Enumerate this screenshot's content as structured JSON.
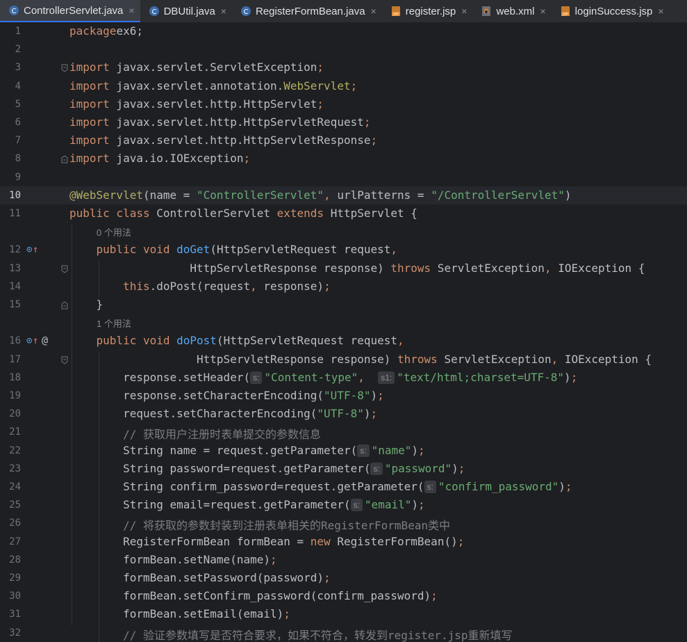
{
  "tabs": [
    {
      "label": "ControllerServlet.java",
      "icon": "java-class-icon",
      "active": true
    },
    {
      "label": "DBUtil.java",
      "icon": "java-class-icon",
      "active": false
    },
    {
      "label": "RegisterFormBean.java",
      "icon": "java-class-icon",
      "active": false
    },
    {
      "label": "register.jsp",
      "icon": "jsp-file-icon",
      "active": false
    },
    {
      "label": "web.xml",
      "icon": "xml-file-icon",
      "active": false
    },
    {
      "label": "loginSuccess.jsp",
      "icon": "jsp-file-icon",
      "active": false
    }
  ],
  "tab_close_glyph": "×",
  "hints": {
    "usages_0": "0 个用法",
    "usages_1": "1 个用法"
  },
  "lines": [
    {
      "n": "1",
      "segs": [
        [
          "kw",
          "package"
        ],
        [
          "",
          "ex6;"
        ]
      ]
    },
    {
      "n": "2",
      "segs": []
    },
    {
      "n": "3",
      "segs": [
        [
          "kw",
          "import"
        ],
        [
          "",
          " javax.servlet.ServletException"
        ],
        [
          "kw",
          ";"
        ]
      ]
    },
    {
      "n": "4",
      "segs": [
        [
          "kw",
          "import"
        ],
        [
          "",
          " javax.servlet.annotation."
        ],
        [
          "ann",
          "WebServlet"
        ],
        [
          "kw",
          ";"
        ]
      ]
    },
    {
      "n": "5",
      "segs": [
        [
          "kw",
          "import"
        ],
        [
          "",
          " javax.servlet.http.HttpServlet"
        ],
        [
          "kw",
          ";"
        ]
      ]
    },
    {
      "n": "6",
      "segs": [
        [
          "kw",
          "import"
        ],
        [
          "",
          " javax.servlet.http.HttpServletRequest"
        ],
        [
          "kw",
          ";"
        ]
      ]
    },
    {
      "n": "7",
      "segs": [
        [
          "kw",
          "import"
        ],
        [
          "",
          " javax.servlet.http.HttpServletResponse"
        ],
        [
          "kw",
          ";"
        ]
      ]
    },
    {
      "n": "8",
      "segs": [
        [
          "kw",
          "import"
        ],
        [
          "",
          " java.io.IOException"
        ],
        [
          "kw",
          ";"
        ]
      ]
    },
    {
      "n": "9",
      "segs": []
    },
    {
      "n": "10",
      "segs": [
        [
          "ann",
          "@WebServlet"
        ],
        [
          "",
          "(name = "
        ],
        [
          "str",
          "\"ControllerServlet\""
        ],
        [
          "kw",
          ","
        ],
        [
          "",
          " urlPatterns = "
        ],
        [
          "str",
          "\"/ControllerServlet\""
        ],
        [
          "",
          ")"
        ]
      ]
    },
    {
      "n": "11",
      "segs": [
        [
          "kw",
          "public class"
        ],
        [
          "",
          " ControllerServlet "
        ],
        [
          "kw",
          "extends"
        ],
        [
          "",
          " HttpServlet {"
        ]
      ]
    },
    {
      "n": "12",
      "segs": [
        [
          "",
          "    "
        ],
        [
          "kw",
          "public void"
        ],
        [
          "",
          " "
        ],
        [
          "fn",
          "doGet"
        ],
        [
          "",
          "(HttpServletRequest request"
        ],
        [
          "kw",
          ","
        ]
      ]
    },
    {
      "n": "13",
      "segs": [
        [
          "",
          "                  HttpServletResponse response) "
        ],
        [
          "kw",
          "throws"
        ],
        [
          "",
          " ServletException"
        ],
        [
          "kw",
          ","
        ],
        [
          "",
          " IOException {"
        ]
      ]
    },
    {
      "n": "14",
      "segs": [
        [
          "",
          "        "
        ],
        [
          "kw",
          "this"
        ],
        [
          "",
          ".doPost(request"
        ],
        [
          "kw",
          ","
        ],
        [
          "",
          " response)"
        ],
        [
          "kw",
          ";"
        ]
      ]
    },
    {
      "n": "15",
      "segs": [
        [
          "",
          "    }"
        ]
      ]
    },
    {
      "n": "16",
      "segs": [
        [
          "",
          "    "
        ],
        [
          "kw",
          "public void"
        ],
        [
          "",
          " "
        ],
        [
          "fn",
          "doPost"
        ],
        [
          "",
          "(HttpServletRequest request"
        ],
        [
          "kw",
          ","
        ]
      ]
    },
    {
      "n": "17",
      "segs": [
        [
          "",
          "                   HttpServletResponse response) "
        ],
        [
          "kw",
          "throws"
        ],
        [
          "",
          " ServletException"
        ],
        [
          "kw",
          ","
        ],
        [
          "",
          " IOException {"
        ]
      ]
    },
    {
      "n": "18",
      "segs": [
        [
          "",
          "        response.setHeader("
        ],
        [
          "ph",
          "s:"
        ],
        [
          "str",
          "\"Content-type\""
        ],
        [
          "kw",
          ","
        ],
        [
          "",
          "  "
        ],
        [
          "ph",
          "s1:"
        ],
        [
          "str",
          "\"text/html;charset=UTF-8\""
        ],
        [
          "",
          ")"
        ],
        [
          "kw",
          ";"
        ]
      ]
    },
    {
      "n": "19",
      "segs": [
        [
          "",
          "        response.setCharacterEncoding("
        ],
        [
          "str",
          "\"UTF-8\""
        ],
        [
          "",
          ")"
        ],
        [
          "kw",
          ";"
        ]
      ]
    },
    {
      "n": "20",
      "segs": [
        [
          "",
          "        request.setCharacterEncoding("
        ],
        [
          "str",
          "\"UTF-8\""
        ],
        [
          "",
          ")"
        ],
        [
          "kw",
          ";"
        ]
      ]
    },
    {
      "n": "21",
      "segs": [
        [
          "",
          "        "
        ],
        [
          "cm",
          "// 获取用户注册时表单提交的参数信息"
        ]
      ]
    },
    {
      "n": "22",
      "segs": [
        [
          "",
          "        String name = request.getParameter("
        ],
        [
          "ph",
          "s:"
        ],
        [
          "str",
          "\"name\""
        ],
        [
          "",
          ")"
        ],
        [
          "kw",
          ";"
        ]
      ]
    },
    {
      "n": "23",
      "segs": [
        [
          "",
          "        String password=request.getParameter("
        ],
        [
          "ph",
          "s:"
        ],
        [
          "str",
          "\"password\""
        ],
        [
          "",
          ")"
        ],
        [
          "kw",
          ";"
        ]
      ]
    },
    {
      "n": "24",
      "segs": [
        [
          "",
          "        String confirm_password=request.getParameter("
        ],
        [
          "ph",
          "s:"
        ],
        [
          "str",
          "\"confirm_password\""
        ],
        [
          "",
          ")"
        ],
        [
          "kw",
          ";"
        ]
      ]
    },
    {
      "n": "25",
      "segs": [
        [
          "",
          "        String email=request.getParameter("
        ],
        [
          "ph",
          "s:"
        ],
        [
          "str",
          "\"email\""
        ],
        [
          "",
          ")"
        ],
        [
          "kw",
          ";"
        ]
      ]
    },
    {
      "n": "26",
      "segs": [
        [
          "",
          "        "
        ],
        [
          "cm",
          "// 将获取的参数封装到注册表单相关的RegisterFormBean类中"
        ]
      ]
    },
    {
      "n": "27",
      "segs": [
        [
          "",
          "        RegisterFormBean formBean = "
        ],
        [
          "kw",
          "new"
        ],
        [
          "",
          " RegisterFormBean()"
        ],
        [
          "kw",
          ";"
        ]
      ]
    },
    {
      "n": "28",
      "segs": [
        [
          "",
          "        formBean.setName(name)"
        ],
        [
          "kw",
          ";"
        ]
      ]
    },
    {
      "n": "29",
      "segs": [
        [
          "",
          "        formBean.setPassword(password)"
        ],
        [
          "kw",
          ";"
        ]
      ]
    },
    {
      "n": "30",
      "segs": [
        [
          "",
          "        formBean.setConfirm_password(confirm_password)"
        ],
        [
          "kw",
          ";"
        ]
      ]
    },
    {
      "n": "31",
      "segs": [
        [
          "",
          "        formBean.setEmail(email)"
        ],
        [
          "kw",
          ";"
        ]
      ]
    },
    {
      "n": "32",
      "segs": [
        [
          "",
          "        "
        ],
        [
          "cm",
          "// 验证参数填写是否符合要求，如果不符合，转发到register.jsp重新填写"
        ]
      ]
    }
  ],
  "gutter_icons": {
    "doGet": [
      "override-icon",
      "implements-arrow-icon"
    ],
    "doPost": [
      "override-icon",
      "implements-arrow-icon",
      "servlet-mapping-icon"
    ],
    "at_glyph": "@"
  },
  "colors": {
    "background": "#1e1f22",
    "keyword": "#cf8e6d",
    "string": "#6aab73",
    "annotation": "#b3ae60",
    "method": "#56a8f5",
    "comment": "#7a7e85",
    "text": "#bcbec4"
  }
}
